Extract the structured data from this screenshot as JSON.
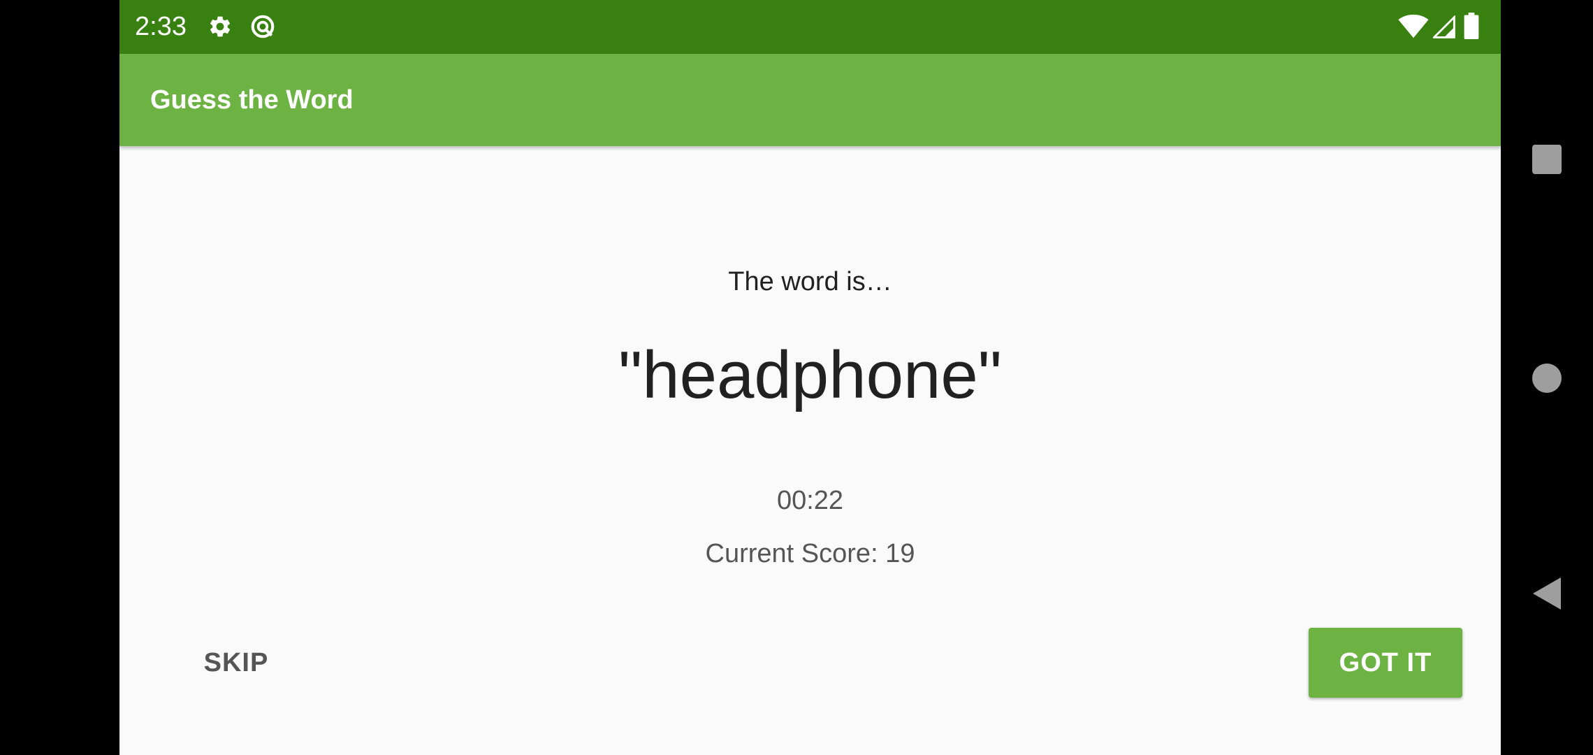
{
  "status_bar": {
    "time": "2:33",
    "icons": [
      "settings-icon",
      "sync-icon",
      "wifi-icon",
      "signal-icon",
      "battery-icon"
    ],
    "background_color": "#38800f"
  },
  "app_bar": {
    "title": "Guess the Word",
    "background_color": "#6db343"
  },
  "game": {
    "intro": "The word is…",
    "word": "\"headphone\"",
    "timer": "00:22",
    "score": "Current Score: 19"
  },
  "buttons": {
    "skip_label": "SKIP",
    "got_it_label": "GOT IT",
    "accent_color": "#6db343"
  },
  "nav_bar": {
    "icons": [
      "recents-icon",
      "home-icon",
      "back-icon"
    ]
  }
}
